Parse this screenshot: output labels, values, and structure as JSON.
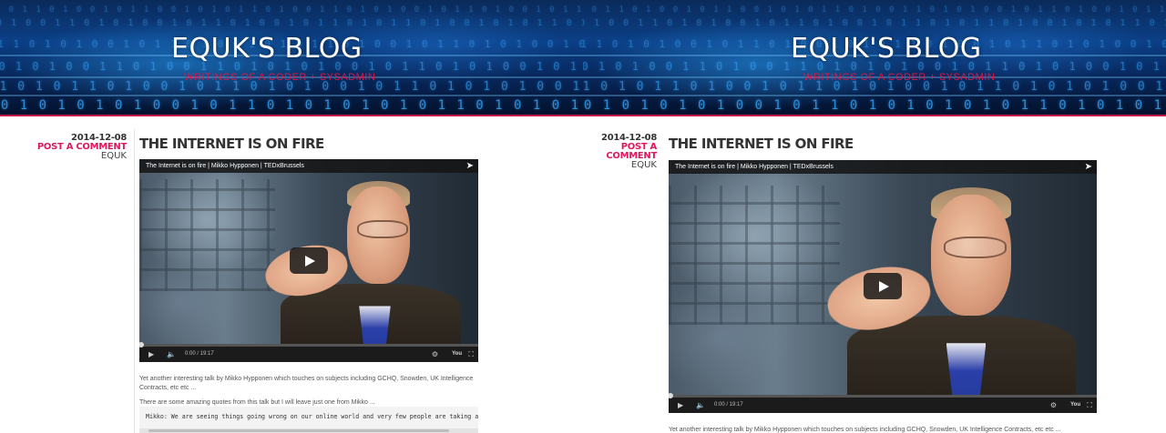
{
  "site": {
    "title": "EQUK'S BLOG",
    "tagline": "WRITINGS OF A CODER + SYSADMIN"
  },
  "post": {
    "date": "2014-12-08",
    "comment_link": "POST A COMMENT",
    "author": "EQUK",
    "title": "THE INTERNET IS ON FIRE",
    "video": {
      "title": "The Internet is on fire | Mikko Hypponen | TEDxBrussels",
      "time": "0:00 / 19:17",
      "progress": 0
    },
    "paragraph1": "Yet another interesting talk by Mikko Hypponen which touches on subjects including GCHQ, Snowden, UK Intelligence Contracts, etc etc ...",
    "paragraph2": "There are some amazing quotes from this talk but I will leave just one from Mikko ...",
    "quote": "Mikko: We are seeing things going wrong on our online world and very few people are taking a"
  },
  "icons": {
    "share": "share-icon",
    "play": "play-icon",
    "volume": "volume-icon",
    "captions": "captions-icon",
    "youtube": "youtube-logo",
    "fullscreen": "fullscreen-icon"
  },
  "colors": {
    "accent": "#e0195a",
    "banner": "#0b3f86",
    "text": "#333333"
  }
}
